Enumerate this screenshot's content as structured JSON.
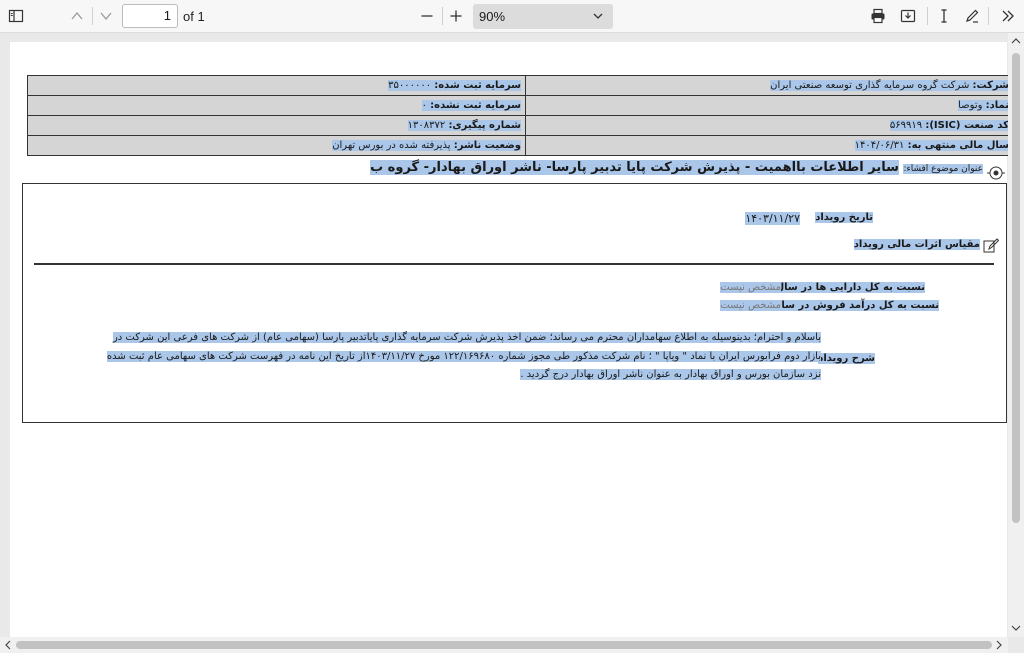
{
  "toolbar": {
    "page_value": "1",
    "page_of": "of 1",
    "zoom": "90%"
  },
  "info": {
    "company_label": "شرکت:",
    "company_value": "شرکت گروه سرمایه گذاری توسعه صنعتی ایران",
    "symbol_label": "نماد:",
    "symbol_value": "وتوصا",
    "isic_label": "کد صنعت (ISIC):",
    "isic_value": "۵۶۹۹۱۹",
    "fiscal_label": "سال مالی منتهی به:",
    "fiscal_value": "۱۴۰۴/۰۶/۳۱",
    "reg_capital_label": "سرمایه ثبت شده:",
    "reg_capital_value": "۳۵۰۰۰۰۰۰",
    "unreg_capital_label": "سرمایه ثبت نشده:",
    "unreg_capital_value": "۰",
    "tracking_label": "شماره پیگیری:",
    "tracking_value": "۱۳۰۸۳۷۲",
    "publisher_status_label": "وضعیت ناشر:",
    "publisher_status_value": "پذیرفته شده در بورس تهران"
  },
  "subject": {
    "label": "عنوان موضوع افشاء:",
    "text": "سایر اطلاعات بااهمیت - پذیرش شرکت پایا تدبیر پارسا- ناشر اوراق بهادار- گروه ب"
  },
  "event": {
    "date_label": "تاریخ رویداد",
    "date_value": "۱۴۰۳/۱۱/۲۷",
    "scale_label": "مقیاس اثرات مالی رویداد",
    "ratio_assets_label": "نسبت به کل دارایی ها در سال مالی قبل",
    "ratio_assets_value": "مشخص نیست",
    "ratio_sales_label": "نسبت به کل درآمد فروش در سال مالی قبل",
    "ratio_sales_value": "مشخص نیست",
    "description_label": "شرح رویداد",
    "description_text": "باسلام و احترام؛ بدینوسیله به اطلاع سهامداران محترم می رساند؛ ضمن اخذ پذیرش شرکت سرمایه گذاری پایاتدبیر پارسا (سهامی عام) از شرکت های فرعی این شرکت در بازار دوم فرابورس ایران با نماد \" ویاپا \" ؛ نام شرکت مذکور طی مجوز شماره ۱۲۲/۱۶۹۶۸۰ مورخ ۱۴۰۳/۱۱/۲۷از تاریخ این نامه در فهرست شرکت های سهامی عام ثبت شده نزد سازمان بورس و اوراق بهادار به عنوان ناشر اوراق بهادار درج گردید ."
  },
  "icons": {
    "sidebar": "sidebar-toggle-icon",
    "prev": "chevron-up-icon",
    "next": "chevron-down-icon",
    "zoom_out": "minus-icon",
    "zoom_in": "plus-icon",
    "print": "printer-icon",
    "save": "save-icon",
    "text_select": "text-cursor-icon",
    "draw": "pen-icon",
    "more": "double-chevron-right-icon"
  },
  "colors": {
    "highlight": "#aac6e8",
    "table_bg": "#d5d5d5"
  }
}
